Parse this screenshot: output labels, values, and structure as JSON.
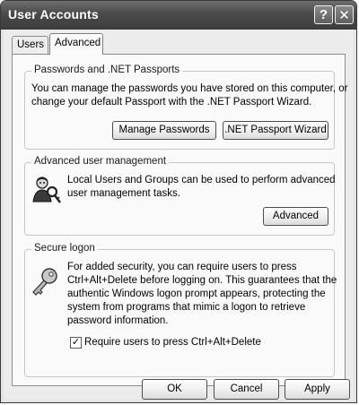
{
  "window": {
    "title": "User Accounts",
    "help_glyph": "?",
    "close_glyph": "✕"
  },
  "tabs": [
    {
      "label": "Users",
      "selected": false
    },
    {
      "label": "Advanced",
      "selected": true
    }
  ],
  "passwords_group": {
    "legend": "Passwords and .NET Passports",
    "description_line1": "You can manage the passwords you have stored on this computer, or",
    "description_line2": "change your default Passport with the .NET Passport Wizard.",
    "manage_button": "Manage Passwords",
    "passport_button": ".NET Passport Wizard"
  },
  "advanced_group": {
    "legend": "Advanced user management",
    "description_line1": "Local Users and Groups can be used to perform advanced",
    "description_line2": "user management tasks.",
    "advanced_button": "Advanced",
    "icon": "users-groups-icon"
  },
  "secure_logon_group": {
    "legend": "Secure logon",
    "description_lines": [
      "For added security, you can require users to press",
      "Ctrl+Alt+Delete before logging on. This guarantees that the",
      "authentic Windows logon prompt appears, protecting the",
      "system from programs that mimic a logon to retrieve",
      "password information."
    ],
    "checkbox_label": "Require users to press Ctrl+Alt+Delete",
    "checkbox_checked": true,
    "checkmark_glyph": "✓",
    "icon": "key-icon"
  },
  "dialog_buttons": {
    "ok": "OK",
    "cancel": "Cancel",
    "apply": "Apply"
  }
}
